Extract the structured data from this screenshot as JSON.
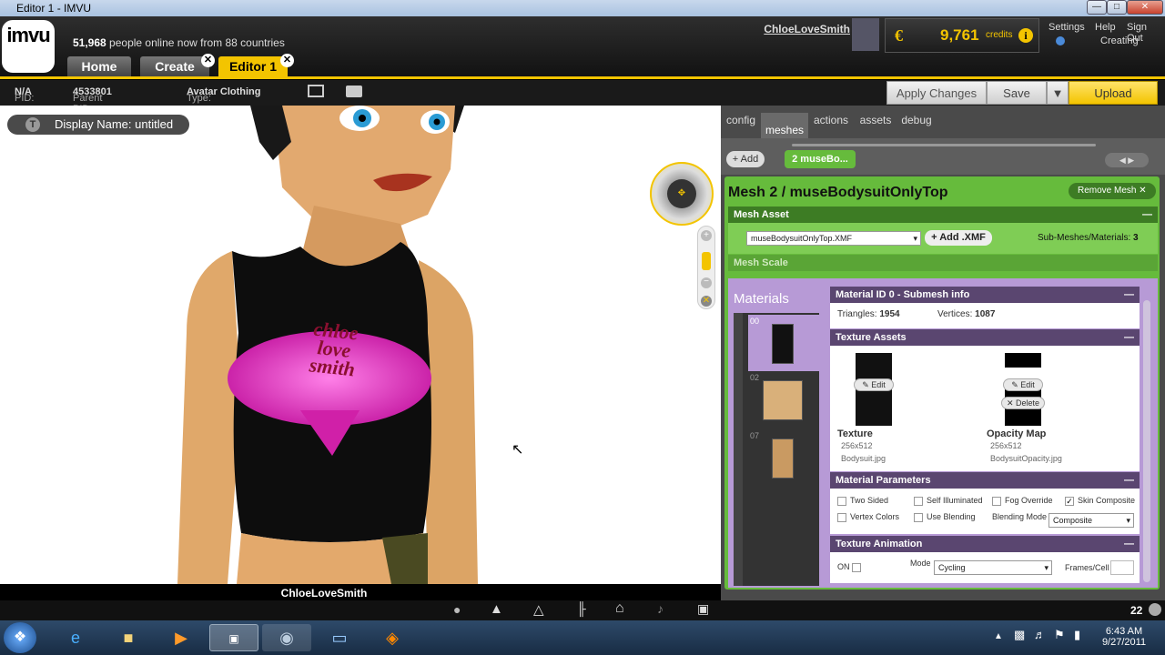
{
  "window": {
    "title": "Editor 1 - IMVU"
  },
  "header": {
    "logo_text": "imvu",
    "online_count": "51,968",
    "online_text": "people online now from 88 countries",
    "tabs": [
      {
        "label": "Home"
      },
      {
        "label": "Create"
      },
      {
        "label": "Editor 1"
      }
    ],
    "username": "ChloeLoveSmith",
    "credits_value": "9,761",
    "credits_label": "credits",
    "links": {
      "settings": "Settings",
      "help": "Help",
      "signout": "Sign Out"
    },
    "status": "Creating"
  },
  "toolbar": {
    "pid_label": "PID:",
    "pid_value": "N/A",
    "parent_pid_label": "Parent PID:",
    "parent_pid_value": "4533801",
    "type_label": "Type:",
    "type_value": "Avatar Clothing",
    "apply_label": "Apply Changes",
    "save_label": "Save",
    "upload_label": "Upload"
  },
  "scene": {
    "display_name": "Display Name: untitled",
    "avatar_name": "ChloeLoveSmith",
    "shirt_text": [
      "chloe",
      "love",
      "smith"
    ]
  },
  "panel": {
    "tabs": [
      {
        "label": "config"
      },
      {
        "label": "meshes"
      },
      {
        "label": "actions"
      },
      {
        "label": "assets"
      },
      {
        "label": "debug"
      }
    ],
    "add_label": "+ Add",
    "mesh_chip": "2 museBo...",
    "mesh_title": "Mesh 2 / museBodysuitOnlyTop",
    "remove_mesh_label": "Remove Mesh",
    "mesh_asset_label": "Mesh Asset",
    "mesh_file": "museBodysuitOnlyTop.XMF",
    "add_xmf_label": "Add .XMF",
    "submesh_label": "Sub-Meshes/Materials:",
    "submesh_value": "3",
    "mesh_scale_label": "Mesh Scale",
    "materials_label": "Materials",
    "material_ids": [
      "00",
      "02",
      "07"
    ],
    "material_info_title": "Material ID 0 - Submesh info",
    "triangles_label": "Triangles:",
    "triangles_value": "1954",
    "vertices_label": "Vertices:",
    "vertices_value": "1087",
    "texture_assets_label": "Texture Assets",
    "edit_label": "Edit",
    "delete_label": "Delete",
    "texture": {
      "name": "Texture",
      "size": "256x512",
      "file": "Bodysuit.jpg"
    },
    "opacity": {
      "name": "Opacity Map",
      "size": "256x512",
      "file": "BodysuitOpacity.jpg"
    },
    "material_params_label": "Material Parameters",
    "params": {
      "two_sided": "Two Sided",
      "self_illuminated": "Self Illuminated",
      "fog_override": "Fog Override",
      "skin_composite": "Skin Composite",
      "vertex_colors": "Vertex Colors",
      "use_blending": "Use Blending",
      "blending_mode_label": "Blending Mode",
      "blending_mode_value": "Composite"
    },
    "texture_animation_label": "Texture Animation",
    "on_label": "ON",
    "mode_label": "Mode",
    "mode_value": "Cycling",
    "frames_label": "Frames/Cell"
  },
  "bottom": {
    "count": "22"
  },
  "taskbar": {
    "time": "6:43 AM",
    "date": "9/27/2011"
  },
  "colors": {
    "accent_gold": "#f3c400",
    "panel_green": "#66bb3c",
    "materials_purple": "#b79ad6"
  }
}
